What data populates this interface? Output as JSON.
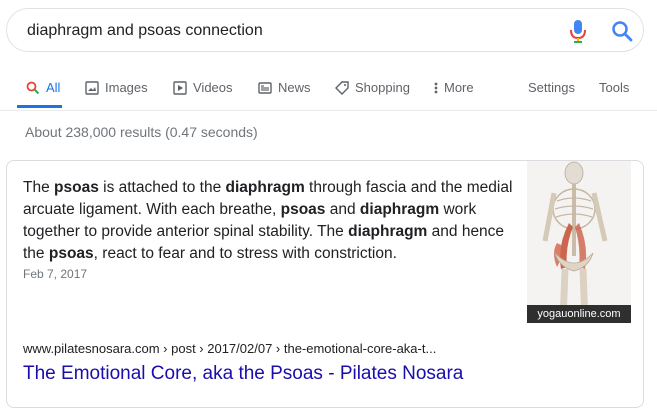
{
  "search": {
    "query": "diaphragm and psoas connection"
  },
  "tabs": [
    {
      "label": "All"
    },
    {
      "label": "Images"
    },
    {
      "label": "Videos"
    },
    {
      "label": "News"
    },
    {
      "label": "Shopping"
    },
    {
      "label": "More"
    }
  ],
  "tools": {
    "settings": "Settings",
    "tools": "Tools"
  },
  "stats": "About 238,000 results (0.47 seconds)",
  "snippet": {
    "parts": [
      {
        "text": "The ",
        "bold": false
      },
      {
        "text": "psoas",
        "bold": true
      },
      {
        "text": " is attached to the ",
        "bold": false
      },
      {
        "text": "diaphragm",
        "bold": true
      },
      {
        "text": " through fascia and the medial arcuate ligament. With each breathe, ",
        "bold": false
      },
      {
        "text": "psoas",
        "bold": true
      },
      {
        "text": " and ",
        "bold": false
      },
      {
        "text": "diaphragm",
        "bold": true
      },
      {
        "text": " work together to provide anterior spinal stability. The ",
        "bold": false
      },
      {
        "text": "diaphragm",
        "bold": true
      },
      {
        "text": " and hence the ",
        "bold": false
      },
      {
        "text": "psoas",
        "bold": true
      },
      {
        "text": ", react to fear and to stress with constriction.",
        "bold": false
      }
    ],
    "date": "Feb 7, 2017",
    "image_source": "yogauonline.com",
    "cite": "www.pilatesnosara.com › post › 2017/02/07 › the-emotional-core-aka-t...",
    "title": "The Emotional Core, aka the Psoas - Pilates Nosara"
  },
  "colors": {
    "link": "#1a0dab",
    "accent": "#1a73e8",
    "muted": "#70757a"
  }
}
